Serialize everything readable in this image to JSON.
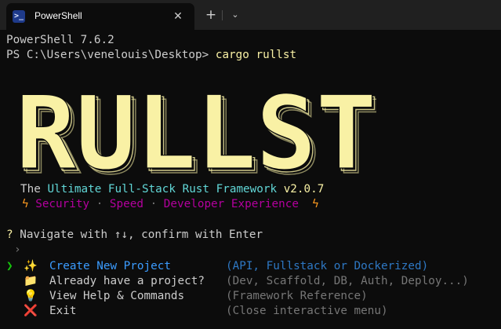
{
  "tab": {
    "icon": "powershell-icon",
    "title": "PowerShell",
    "close_icon": "close-icon",
    "new_tab_icon": "plus-icon",
    "dropdown_icon": "chevron-down-icon"
  },
  "terminal": {
    "version_line": "PowerShell 7.6.2",
    "prompt": "PS C:\\Users\\venelouis\\Desktop> ",
    "command": "cargo rullst"
  },
  "banner": {
    "text": "RULLST",
    "fill_color": "#f9f1a5"
  },
  "tagline": {
    "prefix": "The ",
    "name": "Ultimate Full-Stack Rust Framework",
    "version": " v2.0.7"
  },
  "features": {
    "left_icon": "lightning-icon",
    "items": [
      "Security",
      "Speed",
      "Developer Experience"
    ],
    "separator": " · ",
    "right_icon": "lightning-icon"
  },
  "prompt": {
    "marker": "? ",
    "text": "Navigate with ↑↓, confirm with Enter",
    "cursor": "›"
  },
  "menu": {
    "pointer": "❯",
    "selected_index": 0,
    "items": [
      {
        "icon": "sparkles-icon",
        "glyph": "✨",
        "label": "Create New Project",
        "desc": "(API, Fullstack or Dockerized)"
      },
      {
        "icon": "folder-icon",
        "glyph": "📁",
        "label": "Already have a project?",
        "desc": "(Dev, Scaffold, DB, Auth, Deploy...)"
      },
      {
        "icon": "lightbulb-icon",
        "glyph": "💡",
        "label": "View Help & Commands",
        "desc": "(Framework Reference)"
      },
      {
        "icon": "cross-icon",
        "glyph": "❌",
        "label": "Exit",
        "desc": "(Close interactive menu)"
      }
    ]
  },
  "colors": {
    "background": "#0c0c0c",
    "tab_bar": "#202020",
    "text": "#cccccc",
    "command": "#f9f1a5",
    "cyan": "#61d6d6",
    "magenta": "#b4009e",
    "active": "#3b9cff",
    "pointer": "#16c60c"
  }
}
